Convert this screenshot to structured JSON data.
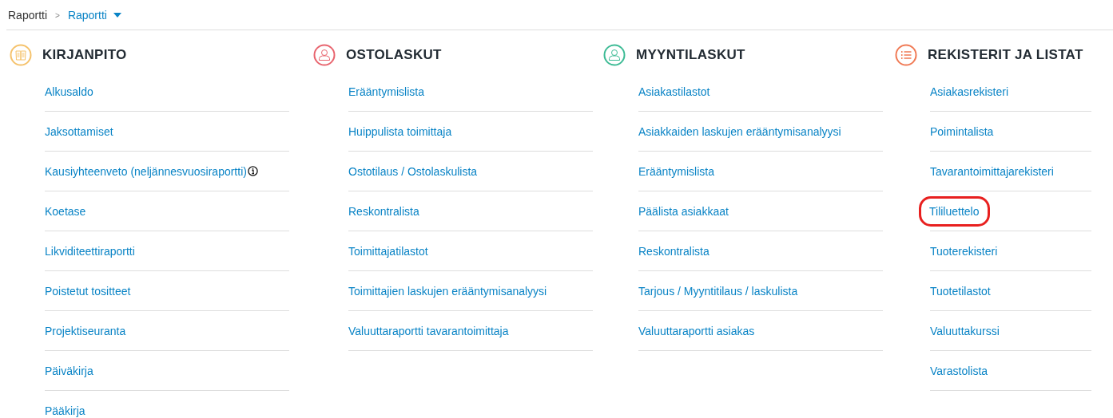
{
  "breadcrumb": {
    "parent": "Raportti",
    "separator": ">",
    "current": "Raportti"
  },
  "sections": [
    {
      "title": "KIRJANPITO",
      "kind": "book",
      "color": "#f5c26b",
      "items": [
        {
          "label": "Alkusaldo",
          "info": false,
          "highlighted": false
        },
        {
          "label": "Jaksottamiset",
          "info": false,
          "highlighted": false
        },
        {
          "label": "Kausiyhteenveto (neljännesvuosiraportti)",
          "info": true,
          "highlighted": false
        },
        {
          "label": "Koetase",
          "info": false,
          "highlighted": false
        },
        {
          "label": "Likviditeettiraportti",
          "info": false,
          "highlighted": false
        },
        {
          "label": "Poistetut tositteet",
          "info": false,
          "highlighted": false
        },
        {
          "label": "Projektiseuranta",
          "info": false,
          "highlighted": false
        },
        {
          "label": "Päiväkirja",
          "info": false,
          "highlighted": false
        },
        {
          "label": "Pääkirja",
          "info": false,
          "highlighted": false
        }
      ]
    },
    {
      "title": "OSTOLASKUT",
      "kind": "person",
      "color": "#e8646e",
      "items": [
        {
          "label": "Erääntymislista",
          "info": false,
          "highlighted": false
        },
        {
          "label": "Huippulista toimittaja",
          "info": false,
          "highlighted": false
        },
        {
          "label": "Ostotilaus / Ostolaskulista",
          "info": false,
          "highlighted": false
        },
        {
          "label": "Reskontralista",
          "info": false,
          "highlighted": false
        },
        {
          "label": "Toimittajatilastot",
          "info": false,
          "highlighted": false
        },
        {
          "label": "Toimittajien laskujen erääntymisanalyysi",
          "info": false,
          "highlighted": false
        },
        {
          "label": "Valuuttaraportti tavarantoimittaja",
          "info": false,
          "highlighted": false
        }
      ]
    },
    {
      "title": "MYYNTILASKUT",
      "kind": "person",
      "color": "#3dbb95",
      "items": [
        {
          "label": "Asiakastilastot",
          "info": false,
          "highlighted": false
        },
        {
          "label": "Asiakkaiden laskujen erääntymisanalyysi",
          "info": false,
          "highlighted": false
        },
        {
          "label": "Erääntymislista",
          "info": false,
          "highlighted": false
        },
        {
          "label": "Päälista asiakkaat",
          "info": false,
          "highlighted": false
        },
        {
          "label": "Reskontralista",
          "info": false,
          "highlighted": false
        },
        {
          "label": "Tarjous / Myyntitilaus / laskulista",
          "info": false,
          "highlighted": false
        },
        {
          "label": "Valuuttaraportti asiakas",
          "info": false,
          "highlighted": false
        }
      ]
    },
    {
      "title": "REKISTERIT JA LISTAT",
      "kind": "list",
      "color": "#f07a55",
      "items": [
        {
          "label": "Asiakasrekisteri",
          "info": false,
          "highlighted": false
        },
        {
          "label": "Poimintalista",
          "info": false,
          "highlighted": false
        },
        {
          "label": "Tavarantoimittajarekisteri",
          "info": false,
          "highlighted": false
        },
        {
          "label": "Tililuettelo",
          "info": false,
          "highlighted": true
        },
        {
          "label": "Tuoterekisteri",
          "info": false,
          "highlighted": false
        },
        {
          "label": "Tuotetilastot",
          "info": false,
          "highlighted": false
        },
        {
          "label": "Valuuttakurssi",
          "info": false,
          "highlighted": false
        },
        {
          "label": "Varastolista",
          "info": false,
          "highlighted": false
        }
      ]
    }
  ]
}
